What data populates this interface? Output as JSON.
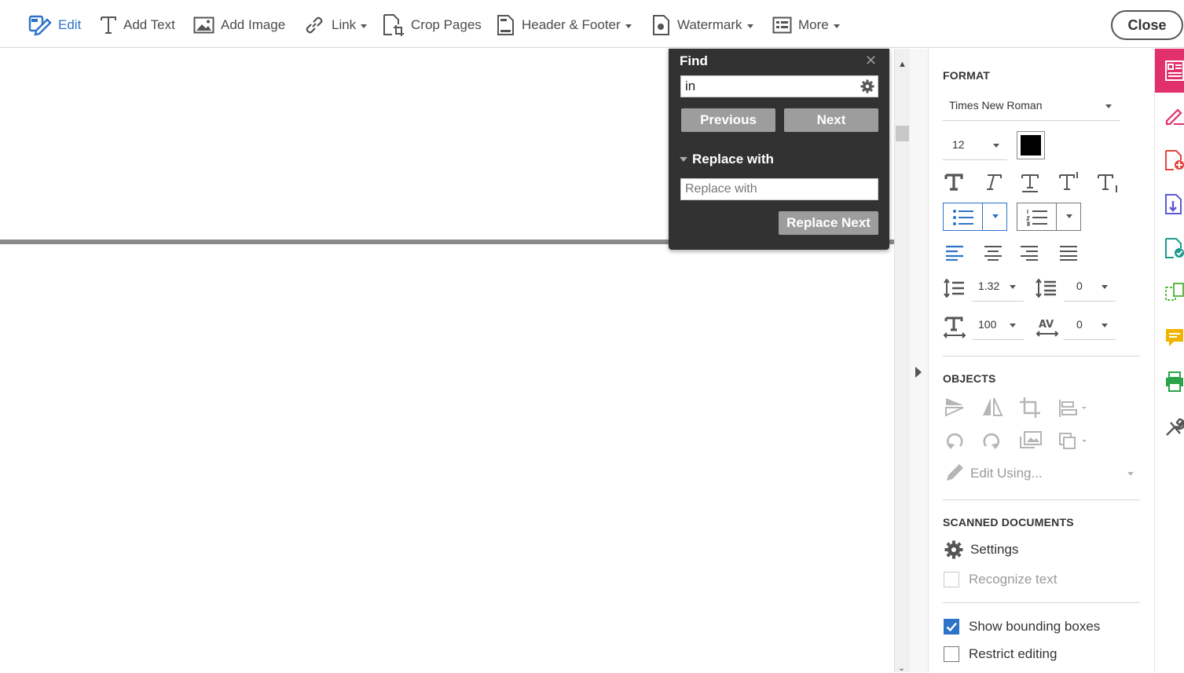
{
  "toolbar": {
    "edit": "Edit",
    "add_text": "Add Text",
    "add_image": "Add Image",
    "link": "Link",
    "crop_pages": "Crop Pages",
    "header_footer": "Header & Footer",
    "watermark": "Watermark",
    "more": "More",
    "close": "Close"
  },
  "find": {
    "title": "Find",
    "query": "in",
    "previous": "Previous",
    "next": "Next",
    "replace_label": "Replace with",
    "replace_placeholder": "Replace with",
    "replace_next": "Replace Next"
  },
  "format": {
    "title": "FORMAT",
    "font": "Times New Roman",
    "size": "12",
    "color": "#000000",
    "line_spacing": "1.32",
    "para_spacing": "0",
    "horizontal_scale": "100",
    "char_spacing": "0"
  },
  "objects": {
    "title": "OBJECTS",
    "edit_using": "Edit Using..."
  },
  "scanned": {
    "title": "SCANNED DOCUMENTS",
    "settings": "Settings",
    "recognize": "Recognize text"
  },
  "options": {
    "bounding": "Show bounding boxes",
    "bounding_checked": true,
    "restrict": "Restrict editing",
    "restrict_checked": false
  },
  "colors": {
    "accent": "#2d73c9",
    "rail_active": "#e2306c"
  }
}
